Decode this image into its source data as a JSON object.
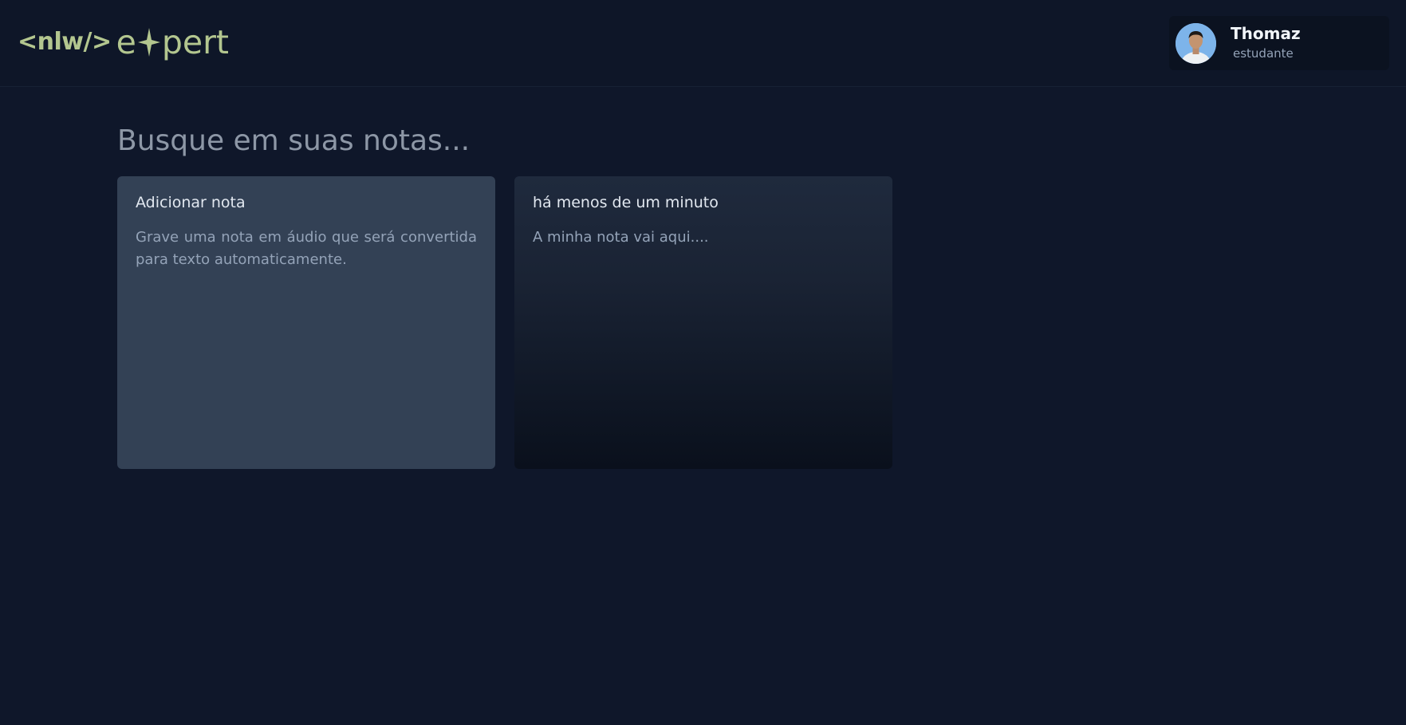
{
  "header": {
    "logo": {
      "code_text": "<nlw/>",
      "word_before": "e",
      "word_after": "pert",
      "accent": "#b3c68f",
      "star_icon": "sparkle-icon"
    },
    "profile": {
      "name": "Thomaz",
      "role": "estudante",
      "avatar_icon": "user-avatar"
    }
  },
  "search": {
    "placeholder": "Busque em suas notas..."
  },
  "cards": {
    "add": {
      "title": "Adicionar nota",
      "description": "Grave uma nota em áudio que será convertida para texto automaticamente."
    },
    "note": {
      "date": "há menos de um minuto",
      "content": "A minha nota vai aqui...."
    }
  },
  "colors": {
    "background": "#0f172a",
    "card_add": "#334155",
    "text_muted": "#94a3b8"
  }
}
